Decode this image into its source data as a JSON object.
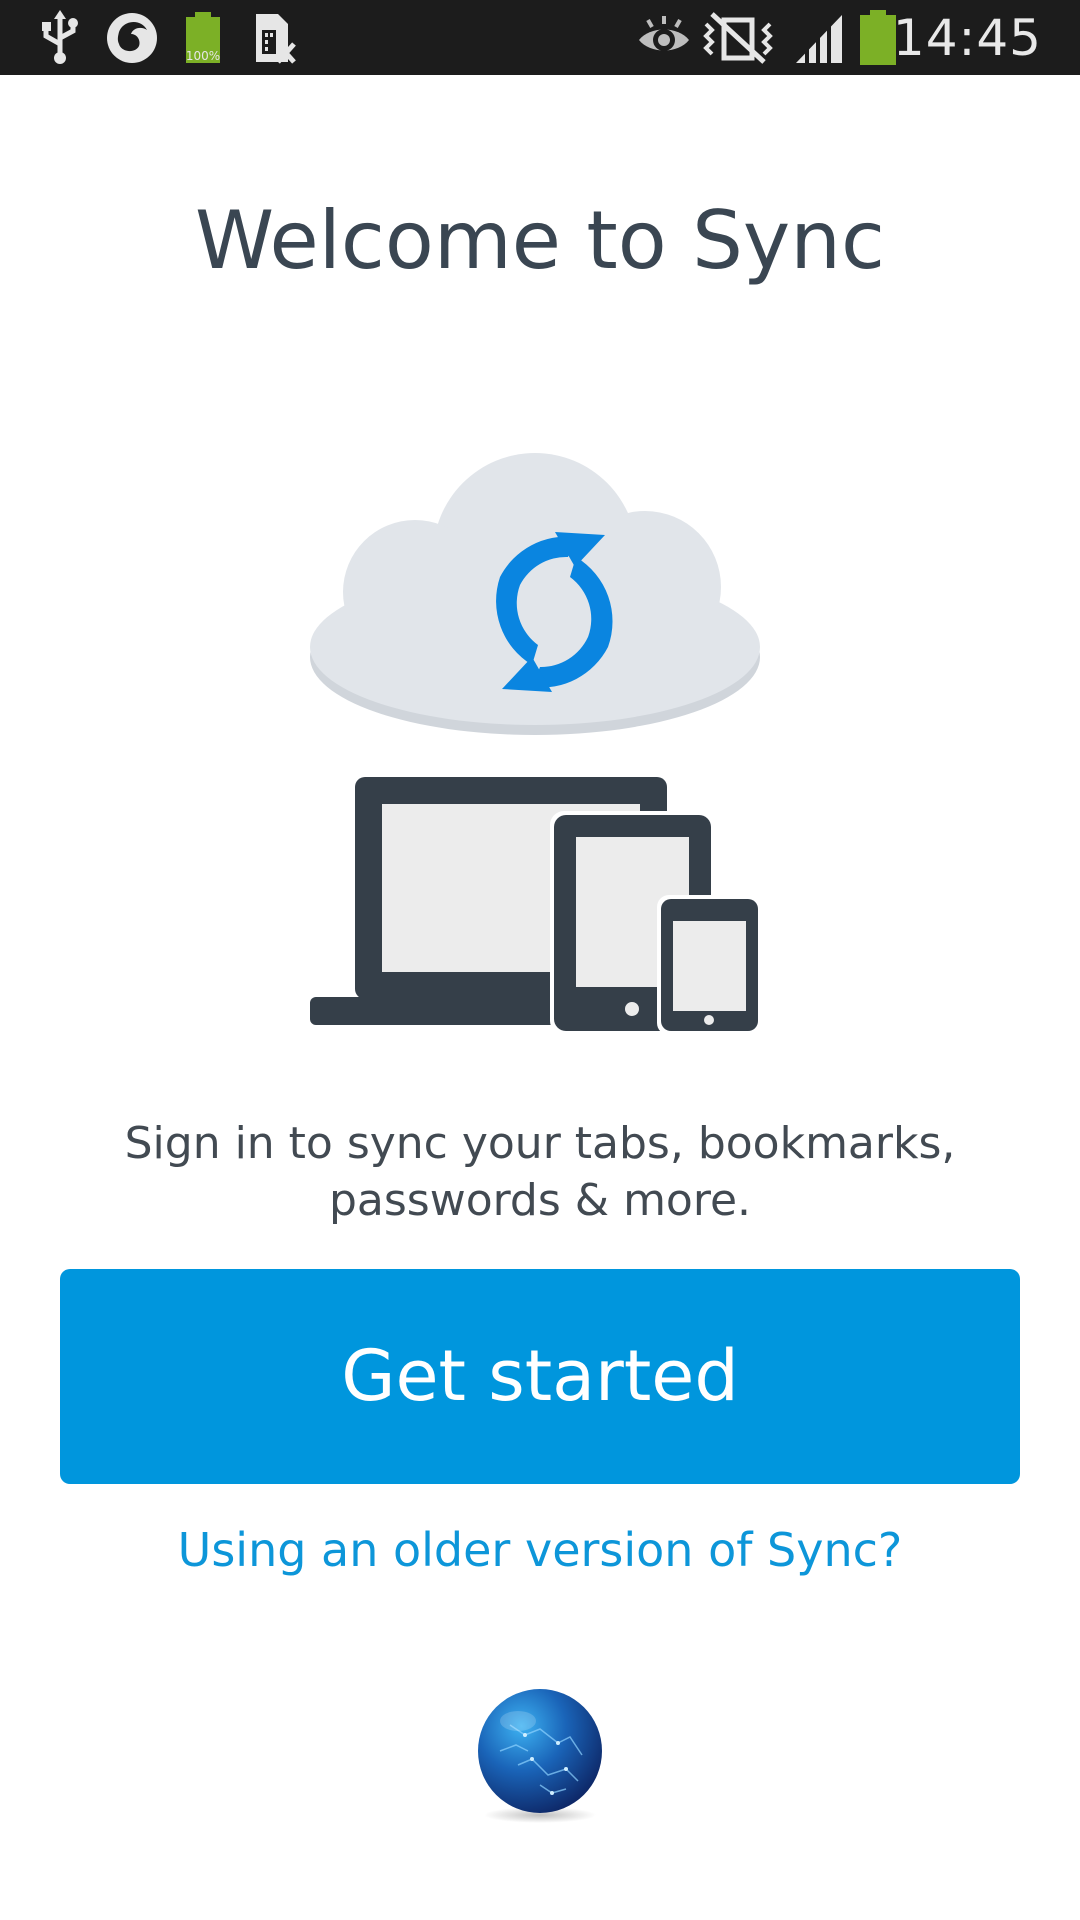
{
  "status_bar": {
    "time": "14:45",
    "battery_percent_icon_text": "100%",
    "icons": [
      "usb-icon",
      "firefox-notification-icon",
      "battery-full-notification-icon",
      "sim-missing-icon",
      "smart-stay-eye-icon",
      "vibrate-mute-icon",
      "signal-icon",
      "battery-icon"
    ],
    "battery_color": "#7cb026"
  },
  "main": {
    "title": "Welcome to Sync",
    "illustration_icons": [
      "cloud-sync-icon",
      "laptop-icon",
      "tablet-icon",
      "phone-icon"
    ],
    "description": "Sign in to sync your tabs, bookmarks, passwords & more.",
    "get_started_label": "Get started",
    "older_version_link": "Using an older version of Sync?",
    "logo_icon": "firefox-nightly-globe-icon"
  },
  "colors": {
    "accent": "#0096dd",
    "link": "#0d96d9",
    "title_text": "#3a4652",
    "sync_arrows": "#0a85e0",
    "cloud": "#e1e5ea",
    "device_frame": "#353f49"
  }
}
